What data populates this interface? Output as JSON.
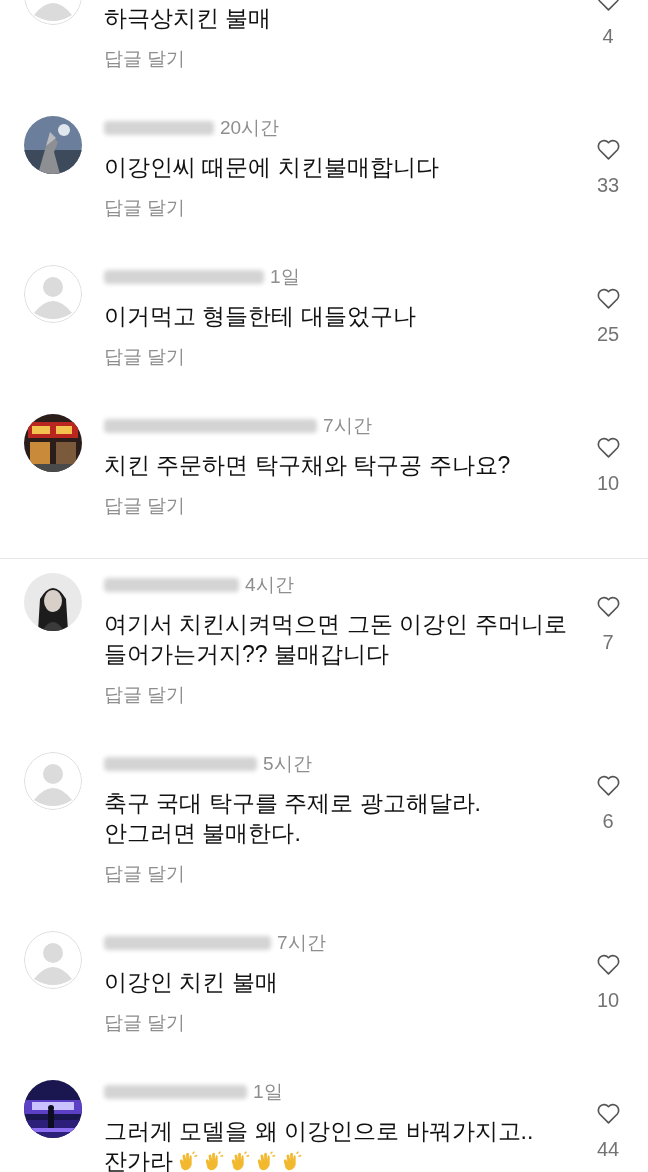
{
  "comments": [
    {
      "avatar": {
        "kind": "default"
      },
      "lines": [
        "하극상치킨 불매"
      ],
      "reply_label": "답글 달기",
      "likes": "4",
      "separated": false
    },
    {
      "avatar": {
        "kind": "picture"
      },
      "time": "20시간",
      "lines": [
        "이강인씨 때문에 치킨불매합니다"
      ],
      "reply_label": "답글 달기",
      "likes": "33",
      "separated": false
    },
    {
      "avatar": {
        "kind": "default"
      },
      "time": "1일",
      "lines": [
        "이거먹고 형들한테 대들었구나"
      ],
      "reply_label": "답글 달기",
      "likes": "25",
      "separated": false
    },
    {
      "avatar": {
        "kind": "picture"
      },
      "time": "7시간",
      "lines": [
        "치킨 주문하면 탁구채와 탁구공 주나요?"
      ],
      "reply_label": "답글 달기",
      "likes": "10",
      "separated": false
    },
    {
      "avatar": {
        "kind": "picture"
      },
      "time": "4시간",
      "lines": [
        "여기서 치킨시켜먹으면 그돈 이강인 주머니로",
        "들어가는거지?? 불매갑니다"
      ],
      "reply_label": "답글 달기",
      "likes": "7",
      "separated": true
    },
    {
      "avatar": {
        "kind": "default"
      },
      "time": "5시간",
      "lines": [
        "축구 국대 탁구를 주제로 광고해달라.",
        "안그러면 불매한다."
      ],
      "reply_label": "답글 달기",
      "likes": "6",
      "separated": false
    },
    {
      "avatar": {
        "kind": "default"
      },
      "time": "7시간",
      "lines": [
        "이강인 치킨 불매"
      ],
      "reply_label": "답글 달기",
      "likes": "10",
      "separated": false
    },
    {
      "avatar": {
        "kind": "picture"
      },
      "time": "1일",
      "lines": [
        "그러게 모델을 왜 이강인으로 바꿔가지고..",
        "잔가라"
      ],
      "likes": "44",
      "separated": false
    }
  ]
}
